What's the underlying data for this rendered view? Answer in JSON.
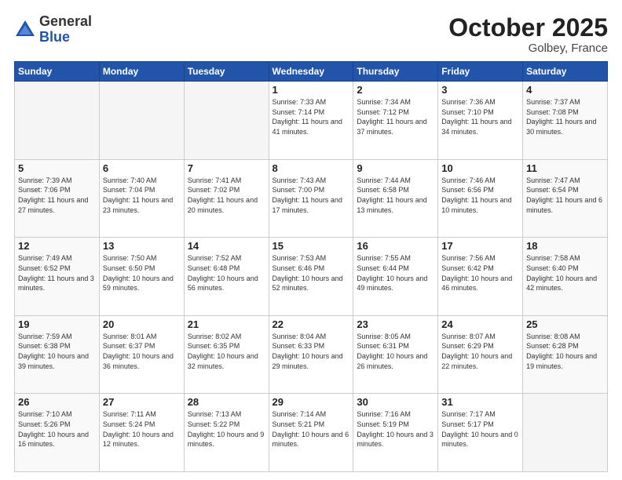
{
  "header": {
    "logo_general": "General",
    "logo_blue": "Blue",
    "month": "October 2025",
    "location": "Golbey, France"
  },
  "weekdays": [
    "Sunday",
    "Monday",
    "Tuesday",
    "Wednesday",
    "Thursday",
    "Friday",
    "Saturday"
  ],
  "weeks": [
    [
      {
        "day": "",
        "info": ""
      },
      {
        "day": "",
        "info": ""
      },
      {
        "day": "",
        "info": ""
      },
      {
        "day": "1",
        "info": "Sunrise: 7:33 AM\nSunset: 7:14 PM\nDaylight: 11 hours\nand 41 minutes."
      },
      {
        "day": "2",
        "info": "Sunrise: 7:34 AM\nSunset: 7:12 PM\nDaylight: 11 hours\nand 37 minutes."
      },
      {
        "day": "3",
        "info": "Sunrise: 7:36 AM\nSunset: 7:10 PM\nDaylight: 11 hours\nand 34 minutes."
      },
      {
        "day": "4",
        "info": "Sunrise: 7:37 AM\nSunset: 7:08 PM\nDaylight: 11 hours\nand 30 minutes."
      }
    ],
    [
      {
        "day": "5",
        "info": "Sunrise: 7:39 AM\nSunset: 7:06 PM\nDaylight: 11 hours\nand 27 minutes."
      },
      {
        "day": "6",
        "info": "Sunrise: 7:40 AM\nSunset: 7:04 PM\nDaylight: 11 hours\nand 23 minutes."
      },
      {
        "day": "7",
        "info": "Sunrise: 7:41 AM\nSunset: 7:02 PM\nDaylight: 11 hours\nand 20 minutes."
      },
      {
        "day": "8",
        "info": "Sunrise: 7:43 AM\nSunset: 7:00 PM\nDaylight: 11 hours\nand 17 minutes."
      },
      {
        "day": "9",
        "info": "Sunrise: 7:44 AM\nSunset: 6:58 PM\nDaylight: 11 hours\nand 13 minutes."
      },
      {
        "day": "10",
        "info": "Sunrise: 7:46 AM\nSunset: 6:56 PM\nDaylight: 11 hours\nand 10 minutes."
      },
      {
        "day": "11",
        "info": "Sunrise: 7:47 AM\nSunset: 6:54 PM\nDaylight: 11 hours\nand 6 minutes."
      }
    ],
    [
      {
        "day": "12",
        "info": "Sunrise: 7:49 AM\nSunset: 6:52 PM\nDaylight: 11 hours\nand 3 minutes."
      },
      {
        "day": "13",
        "info": "Sunrise: 7:50 AM\nSunset: 6:50 PM\nDaylight: 10 hours\nand 59 minutes."
      },
      {
        "day": "14",
        "info": "Sunrise: 7:52 AM\nSunset: 6:48 PM\nDaylight: 10 hours\nand 56 minutes."
      },
      {
        "day": "15",
        "info": "Sunrise: 7:53 AM\nSunset: 6:46 PM\nDaylight: 10 hours\nand 52 minutes."
      },
      {
        "day": "16",
        "info": "Sunrise: 7:55 AM\nSunset: 6:44 PM\nDaylight: 10 hours\nand 49 minutes."
      },
      {
        "day": "17",
        "info": "Sunrise: 7:56 AM\nSunset: 6:42 PM\nDaylight: 10 hours\nand 46 minutes."
      },
      {
        "day": "18",
        "info": "Sunrise: 7:58 AM\nSunset: 6:40 PM\nDaylight: 10 hours\nand 42 minutes."
      }
    ],
    [
      {
        "day": "19",
        "info": "Sunrise: 7:59 AM\nSunset: 6:38 PM\nDaylight: 10 hours\nand 39 minutes."
      },
      {
        "day": "20",
        "info": "Sunrise: 8:01 AM\nSunset: 6:37 PM\nDaylight: 10 hours\nand 36 minutes."
      },
      {
        "day": "21",
        "info": "Sunrise: 8:02 AM\nSunset: 6:35 PM\nDaylight: 10 hours\nand 32 minutes."
      },
      {
        "day": "22",
        "info": "Sunrise: 8:04 AM\nSunset: 6:33 PM\nDaylight: 10 hours\nand 29 minutes."
      },
      {
        "day": "23",
        "info": "Sunrise: 8:05 AM\nSunset: 6:31 PM\nDaylight: 10 hours\nand 26 minutes."
      },
      {
        "day": "24",
        "info": "Sunrise: 8:07 AM\nSunset: 6:29 PM\nDaylight: 10 hours\nand 22 minutes."
      },
      {
        "day": "25",
        "info": "Sunrise: 8:08 AM\nSunset: 6:28 PM\nDaylight: 10 hours\nand 19 minutes."
      }
    ],
    [
      {
        "day": "26",
        "info": "Sunrise: 7:10 AM\nSunset: 5:26 PM\nDaylight: 10 hours\nand 16 minutes."
      },
      {
        "day": "27",
        "info": "Sunrise: 7:11 AM\nSunset: 5:24 PM\nDaylight: 10 hours\nand 12 minutes."
      },
      {
        "day": "28",
        "info": "Sunrise: 7:13 AM\nSunset: 5:22 PM\nDaylight: 10 hours\nand 9 minutes."
      },
      {
        "day": "29",
        "info": "Sunrise: 7:14 AM\nSunset: 5:21 PM\nDaylight: 10 hours\nand 6 minutes."
      },
      {
        "day": "30",
        "info": "Sunrise: 7:16 AM\nSunset: 5:19 PM\nDaylight: 10 hours\nand 3 minutes."
      },
      {
        "day": "31",
        "info": "Sunrise: 7:17 AM\nSunset: 5:17 PM\nDaylight: 10 hours\nand 0 minutes."
      },
      {
        "day": "",
        "info": ""
      }
    ]
  ]
}
